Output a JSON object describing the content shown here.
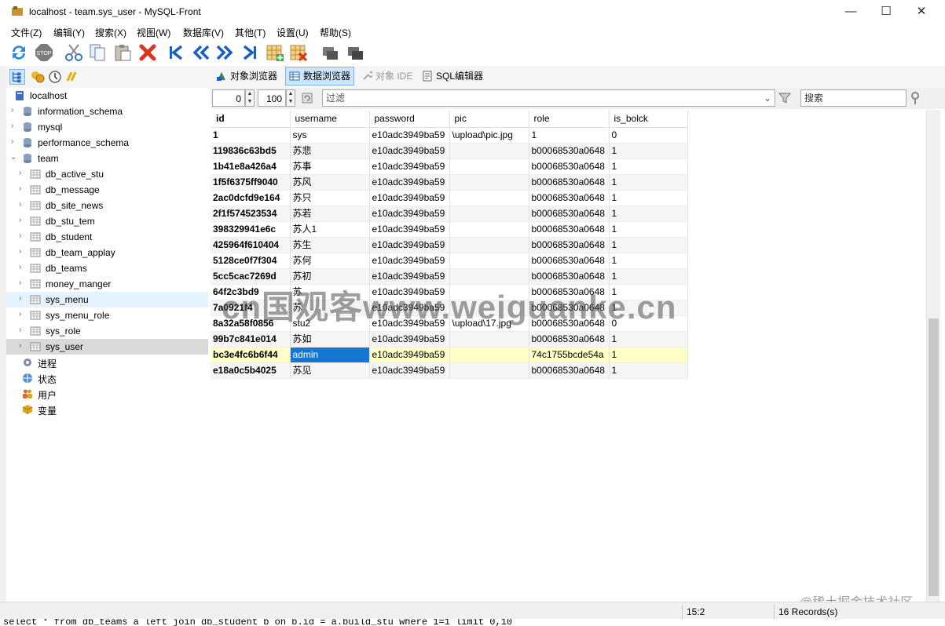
{
  "window": {
    "title": "localhost - team.sys_user - MySQL-Front",
    "controls": {
      "minimize": "—",
      "maximize": "☐",
      "close": "✕"
    }
  },
  "menu": [
    "文件(Z)",
    "编辑(Y)",
    "搜索(X)",
    "视图(W)",
    "数据库(V)",
    "其他(T)",
    "设置(U)",
    "帮助(S)"
  ],
  "toolbar": {
    "icons": [
      "refresh-icon",
      "stop-icon",
      "cut-icon",
      "copy-icon",
      "paste-icon",
      "delete-icon",
      "first-icon",
      "prev-icon",
      "next-icon",
      "last-icon",
      "insert-row-icon",
      "delete-row-icon",
      "post-icon",
      "cancel-icon"
    ]
  },
  "views": {
    "tabs": [
      "对象浏览器",
      "数据浏览器",
      "对象 IDE",
      "SQL编辑器"
    ],
    "active": "数据浏览器"
  },
  "tree": {
    "root": "localhost",
    "databases": [
      "information_schema",
      "mysql",
      "performance_schema",
      "team"
    ],
    "tables": [
      "db_active_stu",
      "db_message",
      "db_site_news",
      "db_stu_tem",
      "db_student",
      "db_team_applay",
      "db_teams",
      "money_manger",
      "sys_menu",
      "sys_menu_role",
      "sys_role",
      "sys_user"
    ],
    "extras": [
      "进程",
      "状态",
      "用户",
      "变量"
    ]
  },
  "filter": {
    "offset": "0",
    "limit": "100",
    "filter_placeholder": "过滤",
    "search_placeholder": "搜索"
  },
  "grid": {
    "columns": [
      "id",
      "username",
      "password",
      "pic",
      "role",
      "is_bolck"
    ],
    "rows": [
      [
        "1",
        "sys",
        "e10adc3949ba59",
        "\\upload\\pic.jpg",
        "1",
        "0"
      ],
      [
        "119836c63bd5",
        "苏悲",
        "e10adc3949ba59",
        "",
        "b00068530a0648",
        "1"
      ],
      [
        "1b41e8a426a4",
        "苏事",
        "e10adc3949ba59",
        "",
        "b00068530a0648",
        "1"
      ],
      [
        "1f5f6375ff9040",
        "苏风",
        "e10adc3949ba59",
        "",
        "b00068530a0648",
        "1"
      ],
      [
        "2ac0dcfd9e164",
        "苏只",
        "e10adc3949ba59",
        "",
        "b00068530a0648",
        "1"
      ],
      [
        "2f1f574523534",
        "苏若",
        "e10adc3949ba59",
        "",
        "b00068530a0648",
        "1"
      ],
      [
        "398329941e6c",
        "苏人1",
        "e10adc3949ba59",
        "",
        "b00068530a0648",
        "1"
      ],
      [
        "425964f610404",
        "苏生",
        "e10adc3949ba59",
        "",
        "b00068530a0648",
        "1"
      ],
      [
        "5128ce0f7f304",
        "苏何",
        "e10adc3949ba59",
        "",
        "b00068530a0648",
        "1"
      ],
      [
        "5cc5cac7269d",
        "苏初",
        "e10adc3949ba59",
        "",
        "b00068530a0648",
        "1"
      ],
      [
        "64f2c3bd9",
        "苏",
        "e10adc3949ba59",
        "",
        "b00068530a0648",
        "1"
      ],
      [
        "7a0921f4",
        "苏",
        "e10adc3949ba59",
        "",
        "b00068530a0648",
        "1"
      ],
      [
        "8a32a58f0856",
        "stu2",
        "e10adc3949ba59",
        "\\upload\\17.jpg",
        "b00068530a0648",
        "0"
      ],
      [
        "99b7c841e014",
        "苏如",
        "e10adc3949ba59",
        "",
        "b00068530a0648",
        "1"
      ],
      [
        "bc3e4fc6b6f44",
        "admin",
        "e10adc3949ba59",
        "",
        "74c1755bcde54a",
        "1"
      ],
      [
        "e18a0c5b4025",
        "苏见",
        "e10adc3949ba59",
        "",
        "b00068530a0648",
        "1"
      ]
    ],
    "current_row": 14
  },
  "status": {
    "position": "15:2",
    "records": "16 Records(s)"
  },
  "sql_text": "select * from db_teams a left join db_student b on b.id = a.build_stu where 1=1 limit 0,10",
  "watermark": "cn国观客www.weiguanke.cn",
  "credit": "@稀土掘金技术社区"
}
